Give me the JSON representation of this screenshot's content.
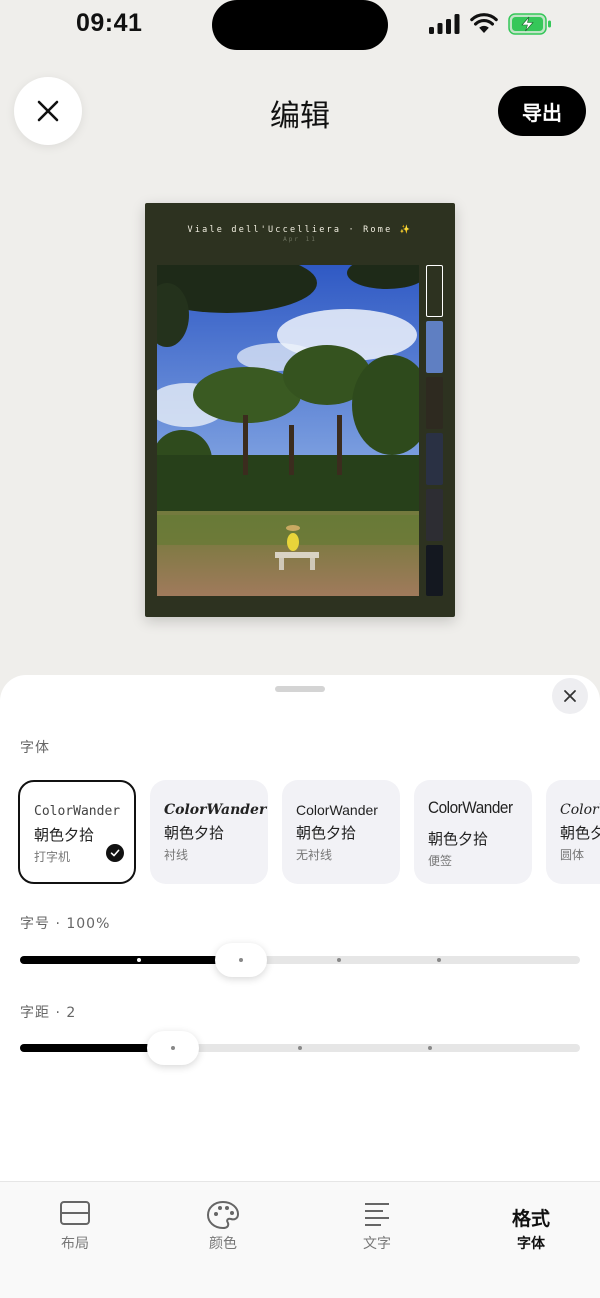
{
  "status_bar": {
    "time": "09:41"
  },
  "header": {
    "title": "编辑",
    "export_label": "导出"
  },
  "preview": {
    "title": "Viale dell'Uccelliera · Rome ✨",
    "subtitle": "Apr 11",
    "background_color": "#2d3220",
    "palette": [
      "#ffffff",
      "#5f7fc2",
      "#2e2a20",
      "#2a3144",
      "#2d2d33",
      "#141820"
    ]
  },
  "sheet": {
    "font_section_label": "字体",
    "fonts": [
      {
        "sample": "ColorWander",
        "cn": "朝色夕拾",
        "tag": "打字机",
        "selected": true
      },
      {
        "sample": "ColorWander",
        "cn": "朝色夕拾",
        "tag": "衬线",
        "selected": false
      },
      {
        "sample": "ColorWander",
        "cn": "朝色夕拾",
        "tag": "无衬线",
        "selected": false
      },
      {
        "sample": "ColorWander",
        "cn": "朝色夕拾",
        "tag": "便签",
        "selected": false
      },
      {
        "sample": "ColorWander",
        "cn": "朝色夕拾",
        "tag": "圆体",
        "selected": false
      }
    ],
    "size_label": "字号 · 100%",
    "size_value_percent": 100,
    "size_level": 0.39,
    "spacing_label": "字距 · 2",
    "spacing_value": 2,
    "spacing_level": 0.27
  },
  "tabs": [
    {
      "label": "布局",
      "icon": "layout-icon"
    },
    {
      "label": "颜色",
      "icon": "palette-icon"
    },
    {
      "label": "文字",
      "icon": "text-lines-icon"
    },
    {
      "label": "格式",
      "sublabel": "字体",
      "active": true
    }
  ],
  "colors": {
    "accent": "#000000",
    "sheet": "#ffffff",
    "background": "#efeeeb",
    "battery": "#35c759"
  }
}
